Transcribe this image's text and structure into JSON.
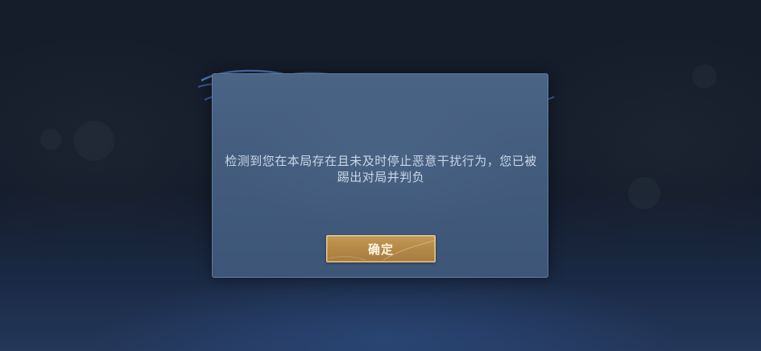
{
  "dialog": {
    "message": "检测到您在本局存在且未及时停止恶意干扰行为，您已被踢出对局并判负",
    "confirm_label": "确定"
  },
  "colors": {
    "dialog_bg": "#435c7d",
    "message_text": "#c9d6e6",
    "button_gold": "#b58a48",
    "button_text": "#fff6e4"
  }
}
